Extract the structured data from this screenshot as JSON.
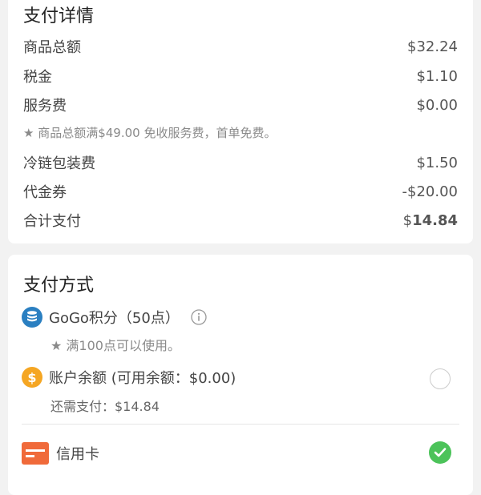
{
  "payment_details": {
    "title": "支付详情",
    "rows": [
      {
        "label": "商品总额",
        "value": "$32.24"
      },
      {
        "label": "税金",
        "value": "$1.10"
      },
      {
        "label": "服务费",
        "value": "$0.00"
      }
    ],
    "service_note": "★ 商品总额满$49.00 免收服务费，首单免费。",
    "rows2": [
      {
        "label": "冷链包装费",
        "value": "$1.50"
      },
      {
        "label": "代金券",
        "value": "-$20.00"
      }
    ],
    "total": {
      "label": "合计支付",
      "currency": "$",
      "amount": "14.84"
    }
  },
  "payment_methods": {
    "title": "支付方式",
    "points": {
      "icon": "database-coins-icon",
      "label": "GoGo积分（50点）",
      "info_icon": "info-icon",
      "note": "★ 满100点可以使用。"
    },
    "balance": {
      "icon": "dollar-coin-icon",
      "label": "账户余额 (可用余额：$0.00)",
      "remaining": "还需支付：$14.84",
      "selected": false
    },
    "credit_card": {
      "icon": "credit-card-icon",
      "label": "信用卡",
      "selected": true
    }
  },
  "colors": {
    "accent_red": "#f04646",
    "points_blue": "#2a7fc1",
    "balance_orange": "#f5a623",
    "card_orange": "#f06a3a",
    "check_green": "#4cc35a"
  }
}
